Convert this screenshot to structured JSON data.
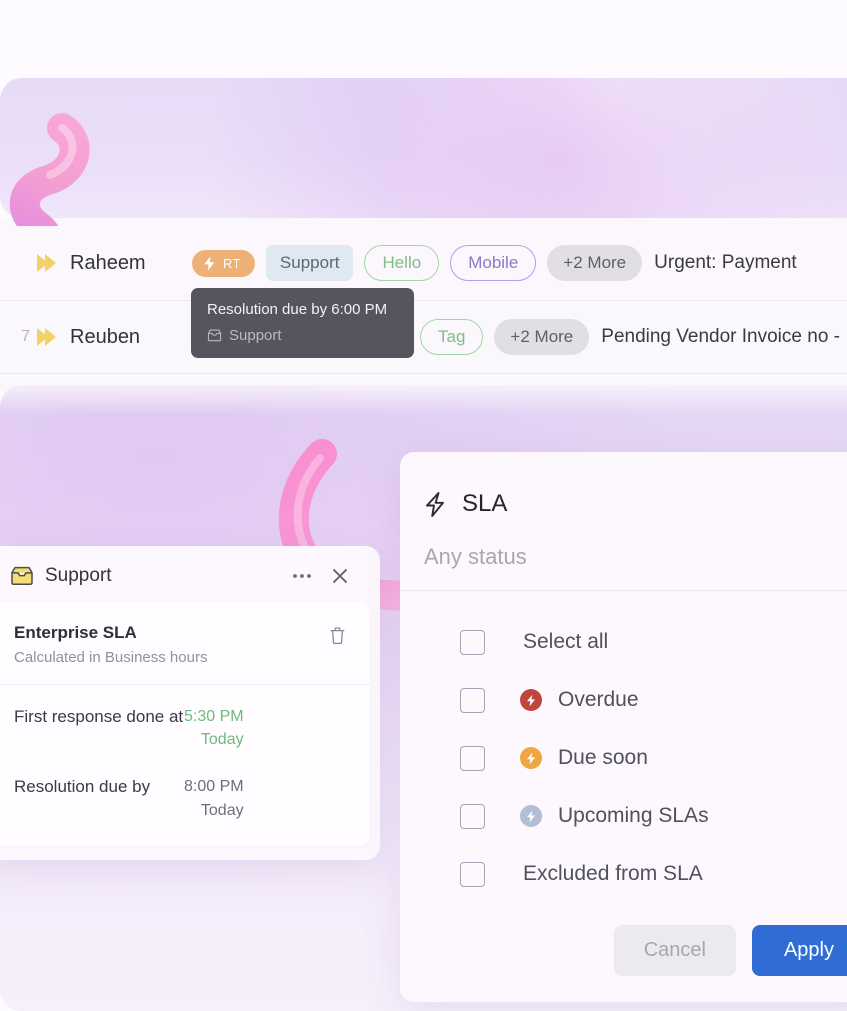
{
  "hero": {
    "decor_squiggle": "pink-ribbon-squiggle-decoration",
    "decor_curve": "pink-ribbon-curve-decoration"
  },
  "ticket_list": {
    "rows": [
      {
        "leading_stub": "",
        "priority_icon": "priority-chevron-icon",
        "requester": "Raheem",
        "sla_badge": {
          "icon": "bolt-icon",
          "label": "RT"
        },
        "group_badge": "Support",
        "tags": [
          {
            "label": "Hello",
            "color": "#7fbd87"
          },
          {
            "label": "Mobile",
            "color": "#8d79c9"
          }
        ],
        "more_label": "+2 More",
        "subject": "Urgent: Payment"
      },
      {
        "leading_stub": "7",
        "priority_icon": "priority-chevron-icon",
        "requester": "Reuben",
        "sla_badge": null,
        "group_badge": null,
        "tags": [
          {
            "label": "Tag",
            "color": "#7fbd87"
          }
        ],
        "more_label": "+2 More",
        "subject": "Pending Vendor Invoice no -"
      }
    ]
  },
  "tooltip": {
    "title": "Resolution due by 6:00 PM",
    "icon": "inbox-icon",
    "group": "Support"
  },
  "sla_card": {
    "header": {
      "icon": "inbox-icon",
      "title": "Support",
      "more_icon": "ellipsis-icon",
      "close_icon": "close-icon"
    },
    "policy": {
      "name": "Enterprise SLA",
      "subtitle": "Calculated in Business hours",
      "delete_icon": "trash-icon"
    },
    "metrics": [
      {
        "label": "First response done at",
        "time": "5:30 PM",
        "day": "Today",
        "state": "met",
        "color": "#6dba7c"
      },
      {
        "label": "Resolution due by",
        "time": "8:00 PM",
        "day": "Today",
        "state": "pending",
        "color": "#6f6d79"
      }
    ]
  },
  "sla_filter": {
    "header": {
      "icon": "bolt-icon",
      "title": "SLA"
    },
    "select": {
      "value": "Any status",
      "caret_icon": "chevron-up-icon",
      "expanded": true
    },
    "options": [
      {
        "label": "Select all",
        "checked": false,
        "icon": null,
        "icon_color": null
      },
      {
        "label": "Overdue",
        "checked": false,
        "icon": "bolt-circle-icon",
        "icon_color": "#c0453f"
      },
      {
        "label": "Due soon",
        "checked": false,
        "icon": "bolt-circle-icon",
        "icon_color": "#eda641"
      },
      {
        "label": "Upcoming SLAs",
        "checked": false,
        "icon": "bolt-circle-icon",
        "icon_color": "#b2bdd6"
      },
      {
        "label": "Excluded from SLA",
        "checked": false,
        "icon": null,
        "icon_color": null
      }
    ],
    "actions": {
      "cancel_label": "Cancel",
      "apply_label": "Apply",
      "apply_color": "#2f6cd4"
    }
  }
}
